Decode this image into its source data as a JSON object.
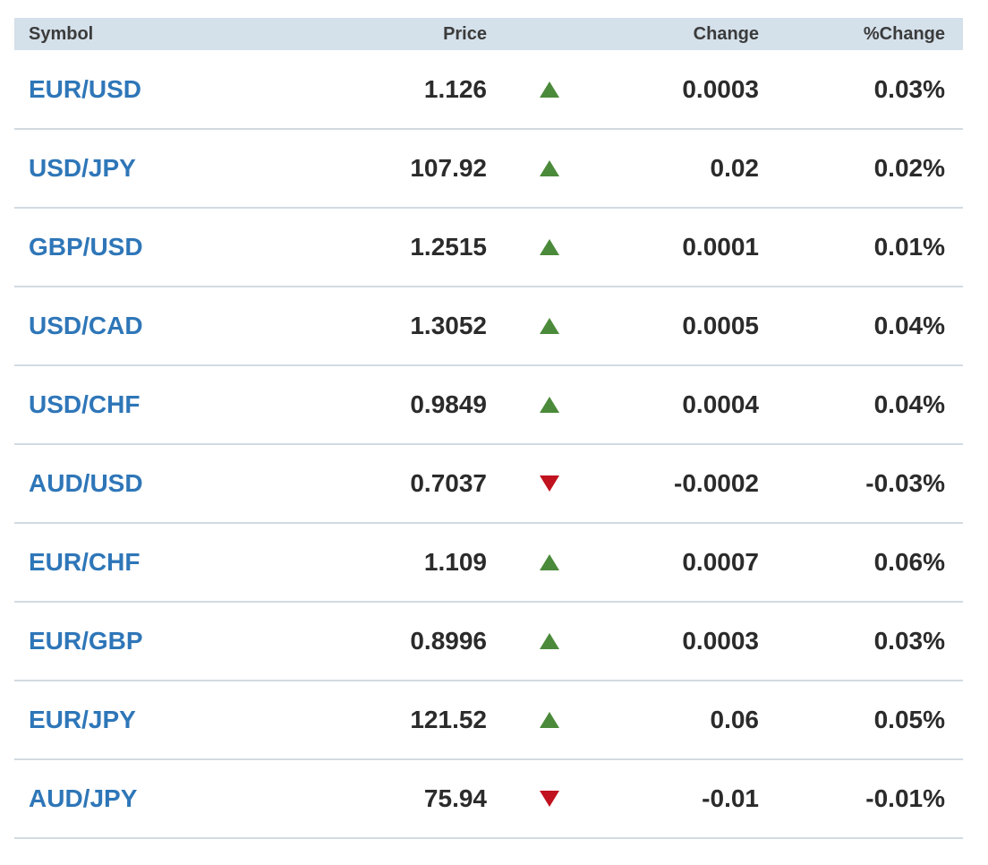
{
  "columns": {
    "symbol": "Symbol",
    "price": "Price",
    "change": "Change",
    "pct_change": "%Change"
  },
  "colors": {
    "header_bg": "#d4e0ea",
    "symbol_link": "#2e76b8",
    "up": "#4b8a3a",
    "down": "#c1121f",
    "row_divider": "#d2dbe2"
  },
  "rows": [
    {
      "symbol": "EUR/USD",
      "price": "1.126",
      "direction": "up",
      "direction_icon": "triangle-up-icon",
      "change": "0.0003",
      "pct_change": "0.03%"
    },
    {
      "symbol": "USD/JPY",
      "price": "107.92",
      "direction": "up",
      "direction_icon": "triangle-up-icon",
      "change": "0.02",
      "pct_change": "0.02%"
    },
    {
      "symbol": "GBP/USD",
      "price": "1.2515",
      "direction": "up",
      "direction_icon": "triangle-up-icon",
      "change": "0.0001",
      "pct_change": "0.01%"
    },
    {
      "symbol": "USD/CAD",
      "price": "1.3052",
      "direction": "up",
      "direction_icon": "triangle-up-icon",
      "change": "0.0005",
      "pct_change": "0.04%"
    },
    {
      "symbol": "USD/CHF",
      "price": "0.9849",
      "direction": "up",
      "direction_icon": "triangle-up-icon",
      "change": "0.0004",
      "pct_change": "0.04%"
    },
    {
      "symbol": "AUD/USD",
      "price": "0.7037",
      "direction": "down",
      "direction_icon": "triangle-down-icon",
      "change": "-0.0002",
      "pct_change": "-0.03%"
    },
    {
      "symbol": "EUR/CHF",
      "price": "1.109",
      "direction": "up",
      "direction_icon": "triangle-up-icon",
      "change": "0.0007",
      "pct_change": "0.06%"
    },
    {
      "symbol": "EUR/GBP",
      "price": "0.8996",
      "direction": "up",
      "direction_icon": "triangle-up-icon",
      "change": "0.0003",
      "pct_change": "0.03%"
    },
    {
      "symbol": "EUR/JPY",
      "price": "121.52",
      "direction": "up",
      "direction_icon": "triangle-up-icon",
      "change": "0.06",
      "pct_change": "0.05%"
    },
    {
      "symbol": "AUD/JPY",
      "price": "75.94",
      "direction": "down",
      "direction_icon": "triangle-down-icon",
      "change": "-0.01",
      "pct_change": "-0.01%"
    }
  ]
}
